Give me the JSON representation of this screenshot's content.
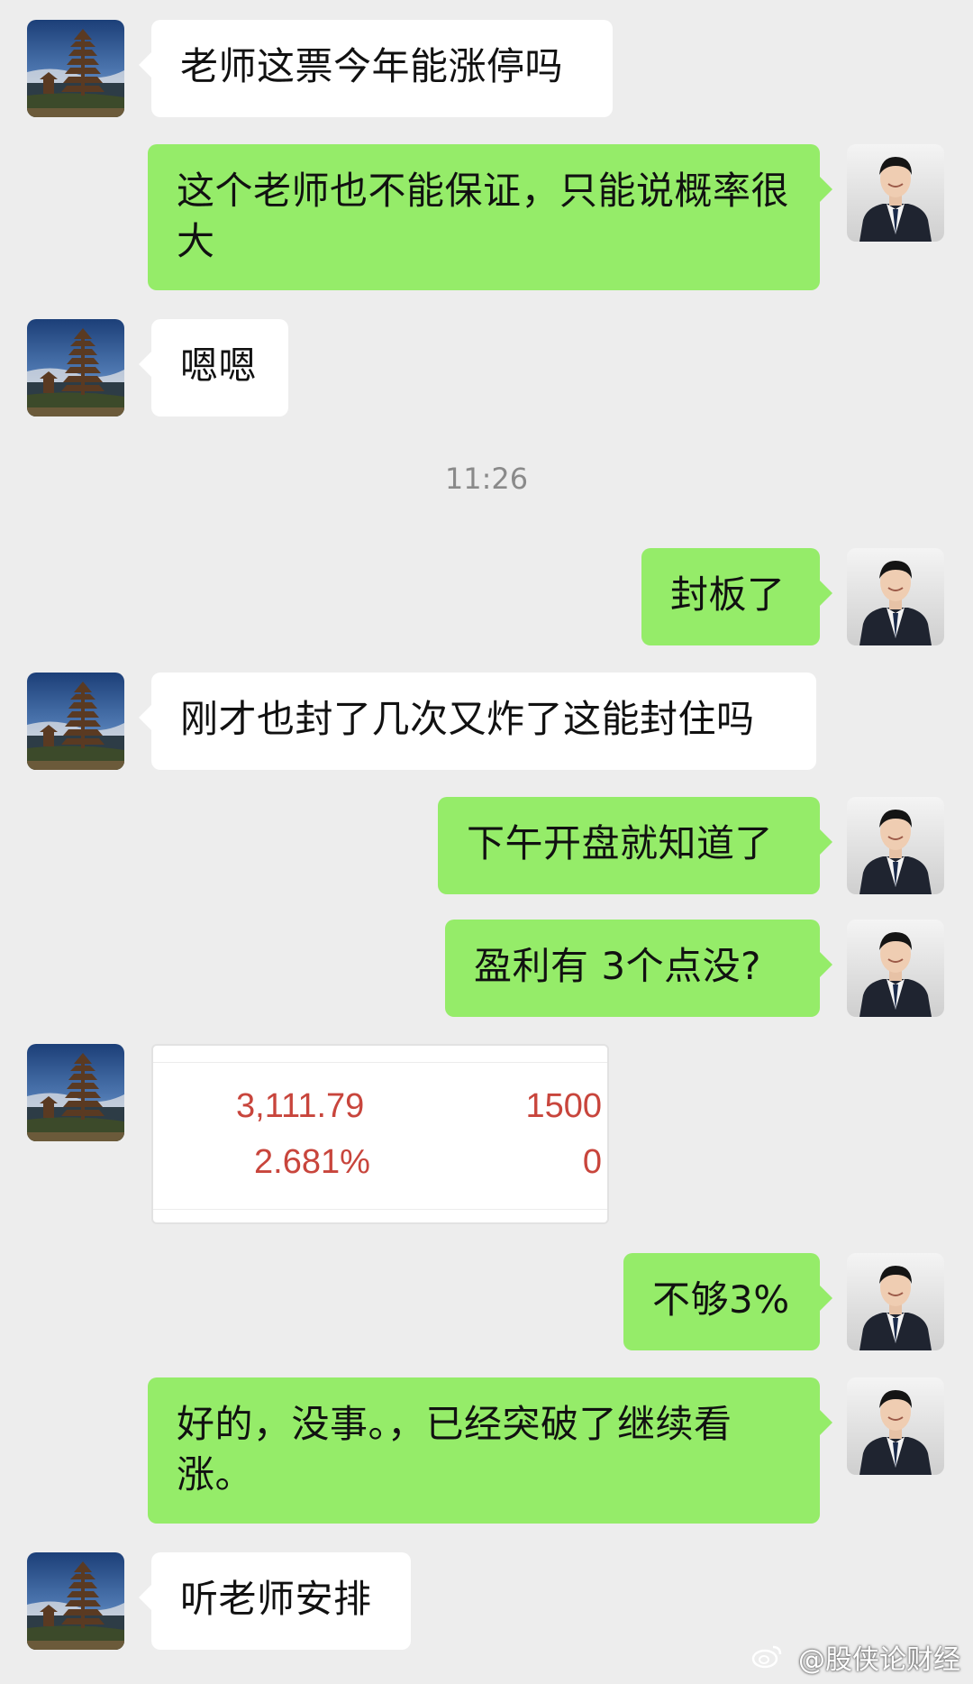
{
  "messages": [
    {
      "text": "老师这票今年能涨停吗"
    },
    {
      "text": "这个老师也不能保证，只能说概率很大"
    },
    {
      "text": "嗯嗯"
    },
    {
      "text": "封板了"
    },
    {
      "text": "刚才也封了几次又炸了这能封住吗"
    },
    {
      "text": "下午开盘就知道了"
    },
    {
      "text": "盈利有 3个点没?"
    },
    {
      "text": "不够3%"
    },
    {
      "text": "好的，没事。，已经突破了继续看涨。"
    },
    {
      "text": "听老师安排"
    }
  ],
  "timestamp": "11:26",
  "screenshot_card": {
    "price": "3,111.79",
    "shares": "1500",
    "percent": "2.681%",
    "available": "0"
  },
  "watermark": {
    "text": "@股侠论财经"
  },
  "colors": {
    "background": "#ededed",
    "outgoing": "#95ec69",
    "incoming": "#ffffff",
    "card_number": "#c8453c"
  }
}
